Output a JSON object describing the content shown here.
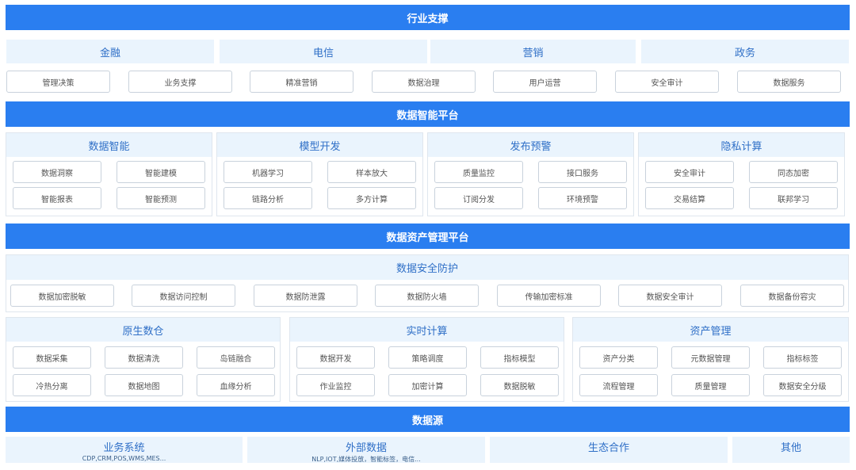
{
  "industry": {
    "title": "行业支撑",
    "sectors": [
      "金融",
      "电信",
      "营销",
      "政务"
    ],
    "items": [
      "管理决策",
      "业务支撑",
      "精准营销",
      "数据治理",
      "用户运营",
      "安全审计",
      "数据服务"
    ]
  },
  "intelligence": {
    "title": "数据智能平台",
    "groups": [
      {
        "title": "数据智能",
        "items": [
          "数据洞察",
          "智能建模",
          "智能报表",
          "智能预测"
        ]
      },
      {
        "title": "模型开发",
        "items": [
          "机器学习",
          "样本放大",
          "链路分析",
          "多方计算"
        ]
      },
      {
        "title": "发布预警",
        "items": [
          "质量监控",
          "接口服务",
          "订阅分发",
          "环境预警"
        ]
      },
      {
        "title": "隐私计算",
        "items": [
          "安全审计",
          "同态加密",
          "交易结算",
          "联邦学习"
        ]
      }
    ]
  },
  "asset": {
    "title": "数据资产管理平台",
    "security": {
      "title": "数据安全防护",
      "items": [
        "数据加密脱敏",
        "数据访问控制",
        "数据防泄露",
        "数据防火墙",
        "传输加密标准",
        "数据安全审计",
        "数据备份容灾"
      ]
    },
    "groups": [
      {
        "title": "原生数仓",
        "items": [
          "数据采集",
          "数据清洗",
          "岛链融合",
          "冷热分离",
          "数据地图",
          "血缘分析"
        ]
      },
      {
        "title": "实时计算",
        "items": [
          "数据开发",
          "策略调度",
          "指标模型",
          "作业监控",
          "加密计算",
          "数据脱敏"
        ]
      },
      {
        "title": "资产管理",
        "items": [
          "资产分类",
          "元数据管理",
          "指标标签",
          "流程管理",
          "质量管理",
          "数据安全分级"
        ]
      }
    ]
  },
  "sources": {
    "title": "数据源",
    "panels": [
      {
        "title": "业务系统",
        "sub": "CDP,CRM,POS,WMS,MES..."
      },
      {
        "title": "外部数据",
        "sub": "NLP,IOT,媒体投放，智能标签，电信..."
      },
      {
        "title": "生态合作",
        "sub": ""
      },
      {
        "title": "其他",
        "sub": ""
      }
    ]
  },
  "colors": {
    "primary": "#2a7ef0",
    "panel": "#eaf4fd",
    "panel_text": "#2f6fc7"
  }
}
